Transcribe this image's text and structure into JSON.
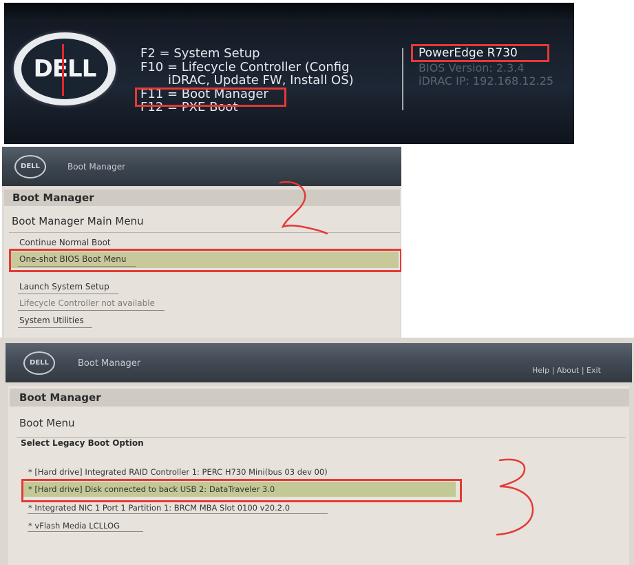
{
  "colors": {
    "annotation": "#e53935",
    "post_background": "#1a2230",
    "menu_background": "#e6e2db",
    "highlight": "#c7c99a"
  },
  "post_screen": {
    "logo": "DELL",
    "keys": [
      {
        "label": "F2  = System Setup"
      },
      {
        "label": "F10 = Lifecycle Controller (Config"
      },
      {
        "label": "iDRAC, Update FW, Install OS)"
      },
      {
        "label": "F11 = Boot Manager"
      },
      {
        "label": "F12 = PXE Boot"
      }
    ],
    "model": "PowerEdge R730",
    "bios_version": "BIOS Version: 2.3.4",
    "idrac_ip": "iDRAC IP:  192.168.12.25"
  },
  "boot_manager_main": {
    "header_logo": "DELL",
    "header_title": "Boot Manager",
    "page_title": "Boot Manager",
    "submenu_title": "Boot Manager Main Menu",
    "items": [
      {
        "label": "Continue Normal Boot"
      },
      {
        "label": "One-shot BIOS Boot Menu"
      },
      {
        "label": "Launch System Setup"
      },
      {
        "label": "Lifecycle Controller not available"
      },
      {
        "label": "System Utilities"
      }
    ],
    "annotation_step": "2"
  },
  "boot_menu": {
    "header_logo": "DELL",
    "header_title": "Boot Manager",
    "header_links": {
      "help": "Help",
      "about": "About",
      "exit": "Exit",
      "separator": "|"
    },
    "page_title": "Boot Manager",
    "submenu_title": "Boot Menu",
    "select_label": "Select Legacy Boot Option",
    "options": [
      {
        "label": "* [Hard drive] Integrated RAID Controller 1: PERC H730 Mini(bus 03 dev 00)"
      },
      {
        "label": "* [Hard drive] Disk connected to back USB 2: DataTraveler 3.0"
      },
      {
        "label": "* Integrated NIC 1 Port 1 Partition 1: BRCM MBA Slot 0100 v20.2.0"
      },
      {
        "label": "* vFlash Media LCLLOG"
      }
    ],
    "annotation_step": "3"
  }
}
